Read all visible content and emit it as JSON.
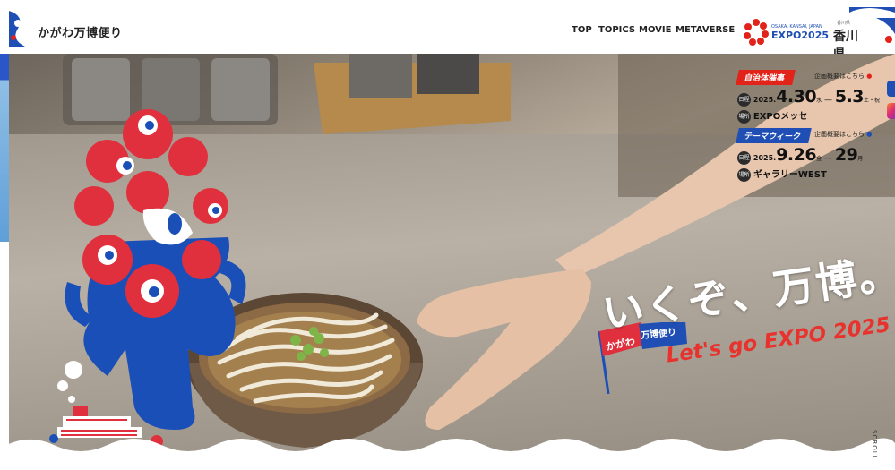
{
  "header": {
    "site_title": "かがわ万博便り",
    "nav": [
      "TOP",
      "TOPICS",
      "MOVIE",
      "METAVERSE"
    ],
    "expo_logo_small": "OSAKA, KANSAI, JAPAN",
    "expo_logo_text": "EXPO2025",
    "pref_logo_small": "香川県",
    "pref_logo_text": "香川県"
  },
  "events": [
    {
      "tag": "自治体催事",
      "tag_color": "#e2231a",
      "link": "企画概要はこちら",
      "date_pill": "日程",
      "year": "2025.",
      "start": "4.30",
      "start_dow": "水",
      "end": "5.3",
      "end_dow": "土・祝",
      "venue_pill": "場所",
      "venue": "EXPOメッセ"
    },
    {
      "tag": "テーマウィーク",
      "tag_color": "#1f4fb4",
      "link": "企画概要はこちら",
      "date_pill": "日程",
      "year": "2025.",
      "start": "9.26",
      "start_dow": "金",
      "end": "29",
      "end_dow": "月",
      "venue_pill": "場所",
      "venue": "ギャラリーWEST"
    }
  ],
  "hero": {
    "flag_line1": "かがわ",
    "flag_line2": "万博便り",
    "headline": "いくぞ、万博。",
    "subline": "Let's go EXPO 2025",
    "scroll": "SCROLL"
  },
  "colors": {
    "red": "#e2231a",
    "blue": "#1f4fb4",
    "mascot_blue": "#1b4fb8",
    "mascot_red": "#e0303d"
  }
}
